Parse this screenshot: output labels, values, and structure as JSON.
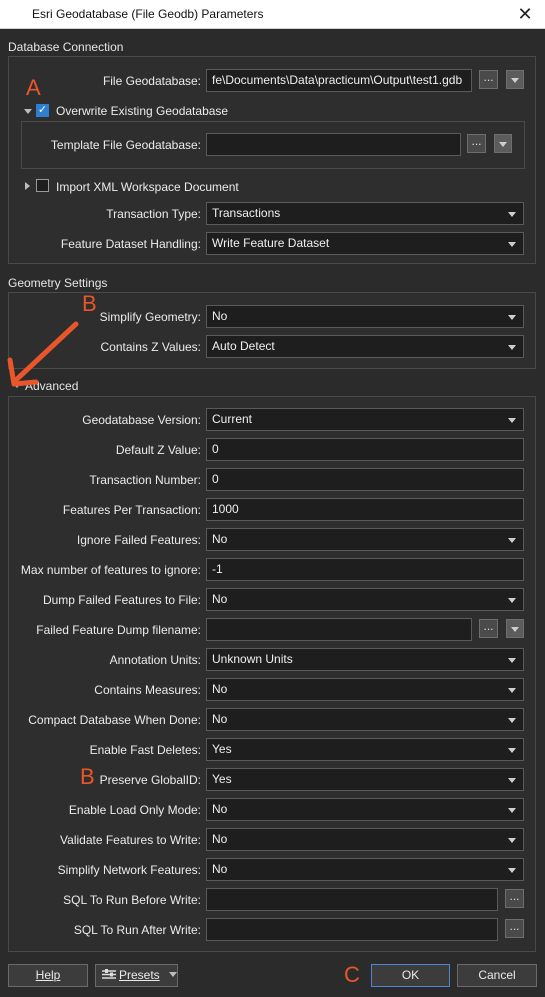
{
  "window": {
    "title": "Esri Geodatabase (File Geodb) Parameters",
    "close_glyph": "✕"
  },
  "database_connection": {
    "heading": "Database Connection",
    "file_gdb_label": "File Geodatabase:",
    "file_gdb_value": "fe\\Documents\\Data\\practicum\\Output\\test1.gdb",
    "overwrite_label": "Overwrite Existing Geodatabase",
    "overwrite_checked": true,
    "template_label": "Template File Geodatabase:",
    "template_value": "",
    "import_xml_label": "Import XML Workspace Document",
    "transaction_type_label": "Transaction Type:",
    "transaction_type_value": "Transactions",
    "feature_dataset_label": "Feature Dataset Handling:",
    "feature_dataset_value": "Write Feature Dataset"
  },
  "geometry": {
    "heading": "Geometry Settings",
    "simplify_label": "Simplify Geometry:",
    "simplify_value": "No",
    "z_values_label": "Contains Z Values:",
    "z_values_value": "Auto Detect"
  },
  "advanced": {
    "heading": "Advanced",
    "rows": [
      {
        "label": "Geodatabase Version:",
        "value": "Current"
      },
      {
        "label": "Default Z Value:",
        "value": "0"
      },
      {
        "label": "Transaction Number:",
        "value": "0"
      },
      {
        "label": "Features Per Transaction:",
        "value": "1000"
      },
      {
        "label": "Ignore Failed Features:",
        "value": "No"
      },
      {
        "label": "Max number of features to ignore:",
        "value": "-1"
      },
      {
        "label": "Dump Failed Features to File:",
        "value": "No"
      },
      {
        "label": "Failed Feature Dump filename:",
        "value": ""
      },
      {
        "label": "Annotation Units:",
        "value": "Unknown Units"
      },
      {
        "label": "Contains Measures:",
        "value": "No"
      },
      {
        "label": "Compact Database When Done:",
        "value": "No"
      },
      {
        "label": "Enable Fast Deletes:",
        "value": "Yes"
      },
      {
        "label": "Preserve GlobalID:",
        "value": "Yes"
      },
      {
        "label": "Enable Load Only Mode:",
        "value": "No"
      },
      {
        "label": "Validate Features to Write:",
        "value": "No"
      },
      {
        "label": "Simplify Network Features:",
        "value": "No"
      },
      {
        "label": "SQL To Run Before Write:",
        "value": ""
      },
      {
        "label": "SQL To Run After Write:",
        "value": ""
      }
    ]
  },
  "ellipsis": "...",
  "annotations": {
    "a": "A",
    "b1": "B",
    "b2": "B",
    "c": "C"
  },
  "footer": {
    "help": "Help",
    "presets": "Presets",
    "ok": "OK",
    "cancel": "Cancel"
  },
  "colors": {
    "accent": "#e8562a",
    "background": "#2b2b2b",
    "primary_border": "#4b86d0"
  },
  "icons": {
    "presets": "presets-icon",
    "arrow": "arrow-annotation-icon"
  }
}
